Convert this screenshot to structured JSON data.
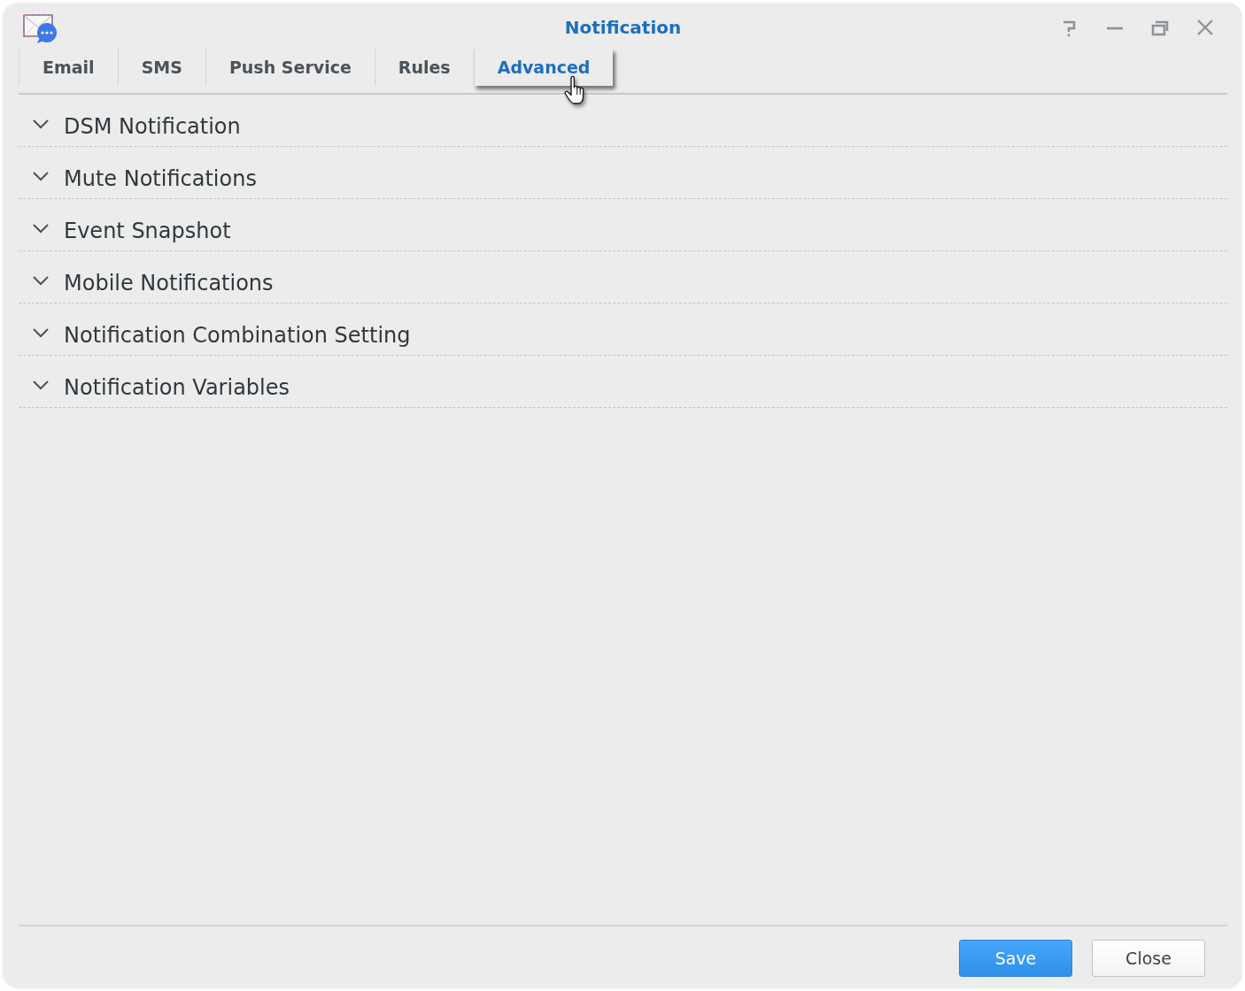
{
  "window": {
    "title": "Notification"
  },
  "tabs": [
    {
      "label": "Email",
      "selected": false
    },
    {
      "label": "SMS",
      "selected": false
    },
    {
      "label": "Push Service",
      "selected": false
    },
    {
      "label": "Rules",
      "selected": false
    },
    {
      "label": "Advanced",
      "selected": true
    }
  ],
  "sections": [
    {
      "label": "DSM Notification",
      "expanded": false
    },
    {
      "label": "Mute Notifications",
      "expanded": false
    },
    {
      "label": "Event Snapshot",
      "expanded": false
    },
    {
      "label": "Mobile Notifications",
      "expanded": false
    },
    {
      "label": "Notification Combination Setting",
      "expanded": false
    },
    {
      "label": "Notification Variables",
      "expanded": false
    }
  ],
  "buttons": [
    {
      "label": "Save",
      "kind": "primary"
    },
    {
      "label": "Close",
      "kind": "secondary"
    }
  ]
}
